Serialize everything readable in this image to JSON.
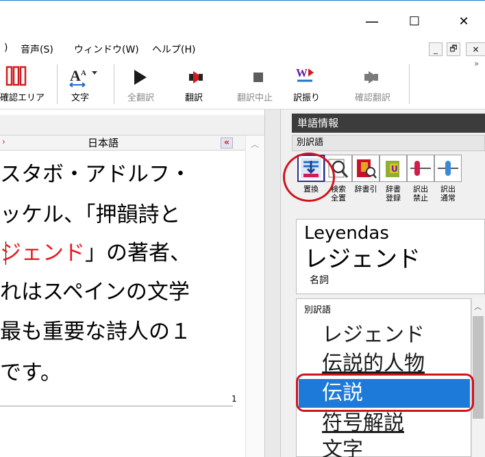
{
  "titlebar": {
    "minimize_symbol": "—",
    "maximize_symbol": "☐",
    "close_symbol": "✕"
  },
  "menubar": {
    "items": [
      ")",
      "音声(S)",
      "ウィンドウ(W)",
      "ヘルプ(H)"
    ],
    "mdi_min": "_",
    "mdi_restore": "🗗",
    "mdi_close": "×",
    "overflow": "»"
  },
  "toolbar": {
    "items": [
      {
        "label": "確認エリア",
        "enabled": true
      },
      {
        "label": "文字",
        "enabled": true
      },
      {
        "label": "全翻訳",
        "enabled": false
      },
      {
        "label": "翻訳",
        "enabled": true
      },
      {
        "label": "翻訳中止",
        "enabled": false
      },
      {
        "label": "訳振り",
        "enabled": true
      },
      {
        "label": "確認翻訳",
        "enabled": false
      }
    ],
    "overflow": "»"
  },
  "document": {
    "column_header": "日本語",
    "collapse_symbol": "«",
    "lines": [
      {
        "text": "スタボ・アドルフ・",
        "highlight": ""
      },
      {
        "text": "ッケル、「押韻詩と",
        "highlight": ""
      },
      {
        "text_red": "ジェンド",
        "text_rest": "」の著者、"
      },
      {
        "text": "れはスペインの文学",
        "highlight": ""
      },
      {
        "text": "最も重要な詩人の１",
        "highlight": ""
      },
      {
        "text": "です。",
        "highlight": ""
      }
    ],
    "page_number": "1"
  },
  "splitter": {
    "expand_symbol": "»"
  },
  "word_panel": {
    "title": "単語情報",
    "tab_label": "別訳語",
    "tools": [
      {
        "label": "置換",
        "icon": "replace-icon"
      },
      {
        "label": "検索\n全置",
        "icon": "search-replace-all-icon"
      },
      {
        "label": "辞書引",
        "icon": "dictionary-lookup-icon"
      },
      {
        "label": "辞書\n登録",
        "icon": "dictionary-register-icon"
      },
      {
        "label": "訳出\n禁止",
        "icon": "translation-prohibit-icon"
      },
      {
        "label": "訳出\n通常",
        "icon": "translation-normal-icon"
      }
    ],
    "source_word": "Leyendas",
    "translation": "レジェンド",
    "part_of_speech": "名詞",
    "alt_header": "別訳語",
    "alternatives": [
      "レジェンド",
      "伝説的人物",
      "伝説",
      "符号解説",
      "文字"
    ],
    "selected_index": 2,
    "accent": "#1e7ad8",
    "callout_color": "#d0121b"
  }
}
